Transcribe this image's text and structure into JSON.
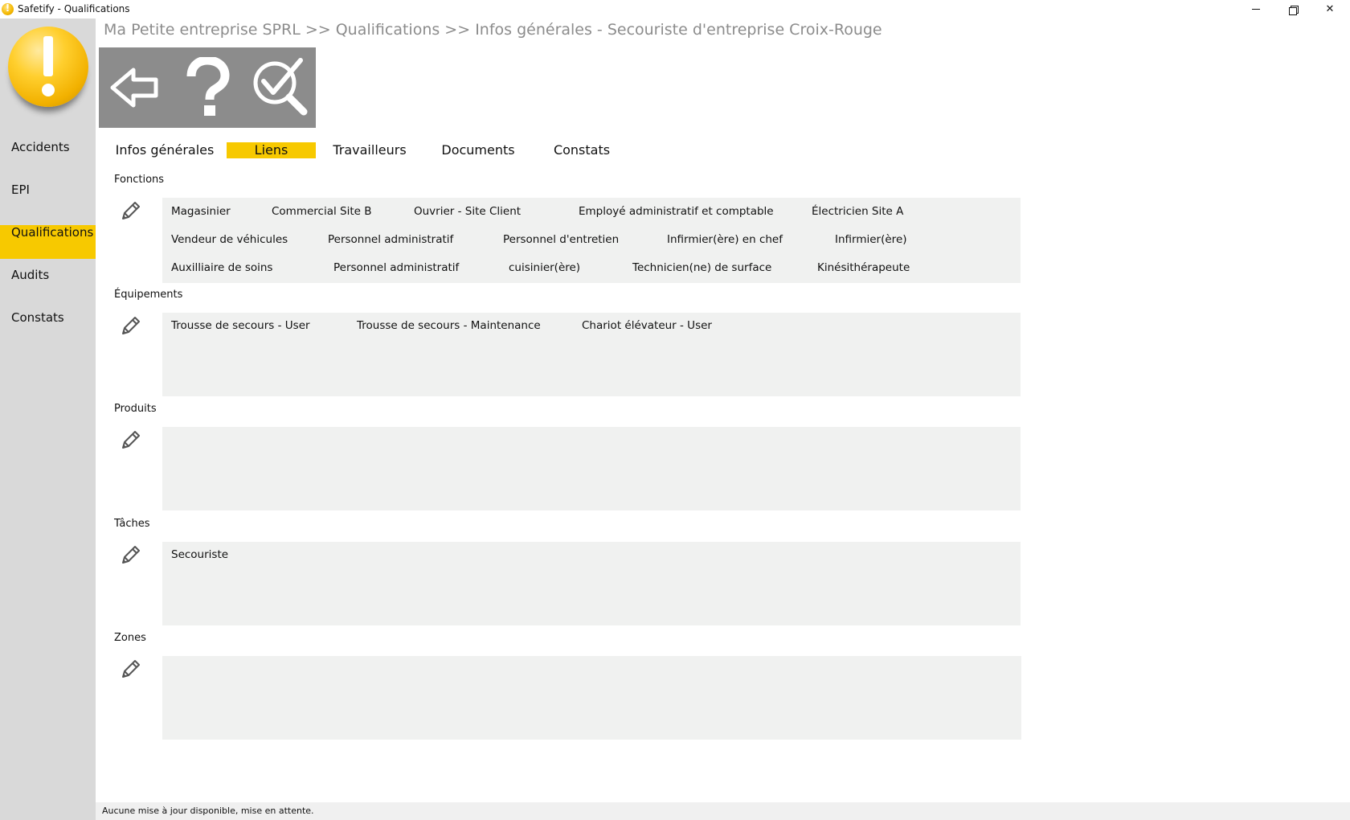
{
  "window": {
    "title": "Safetify - Qualifications",
    "minimize_label": "",
    "restore_label": "",
    "close_label": "✕"
  },
  "sidebar": {
    "items": [
      {
        "label": "Accidents"
      },
      {
        "label": "EPI"
      },
      {
        "label": "Qualifications",
        "active": true
      },
      {
        "label": "Audits"
      },
      {
        "label": "Constats"
      }
    ]
  },
  "breadcrumb": "Ma Petite entreprise SPRL >> Qualifications >> Infos générales - Secouriste d'entreprise Croix-Rouge",
  "toolbar": {
    "buttons": [
      {
        "icon": "back-arrow-icon"
      },
      {
        "icon": "help-icon"
      },
      {
        "icon": "search-check-icon"
      }
    ]
  },
  "tabs": [
    {
      "label": "Infos générales"
    },
    {
      "label": "Liens",
      "active": true
    },
    {
      "label": "Travailleurs"
    },
    {
      "label": "Documents"
    },
    {
      "label": "Constats"
    }
  ],
  "sections": {
    "fonctions": {
      "label": "Fonctions",
      "items": [
        "Magasinier",
        "Commercial Site B",
        "Ouvrier - Site Client",
        "Employé administratif et comptable",
        "Électricien Site A",
        "Vendeur de véhicules",
        "Personnel administratif",
        "Personnel d'entretien",
        "Infirmier(ère) en chef",
        "Infirmier(ère)",
        "Auxilliaire de soins",
        "Personnel administratif",
        "cuisinier(ère)",
        "Technicien(ne) de surface",
        "Kinésithérapeute"
      ]
    },
    "equipements": {
      "label": "Équipements",
      "items": [
        "Trousse de secours - User",
        "Trousse de secours - Maintenance",
        "Chariot élévateur - User"
      ]
    },
    "produits": {
      "label": "Produits",
      "items": []
    },
    "taches": {
      "label": "Tâches",
      "items": [
        "Secouriste"
      ]
    },
    "zones": {
      "label": "Zones",
      "items": []
    }
  },
  "statusbar": {
    "text": "Aucune mise à jour disponible, mise en attente."
  },
  "colors": {
    "accent": "#f7c900",
    "sidebar": "#d9d9d9",
    "toolbar": "#8c8c8c",
    "panel": "#f0f1f0",
    "breadcrumb": "#8c8c8c"
  }
}
